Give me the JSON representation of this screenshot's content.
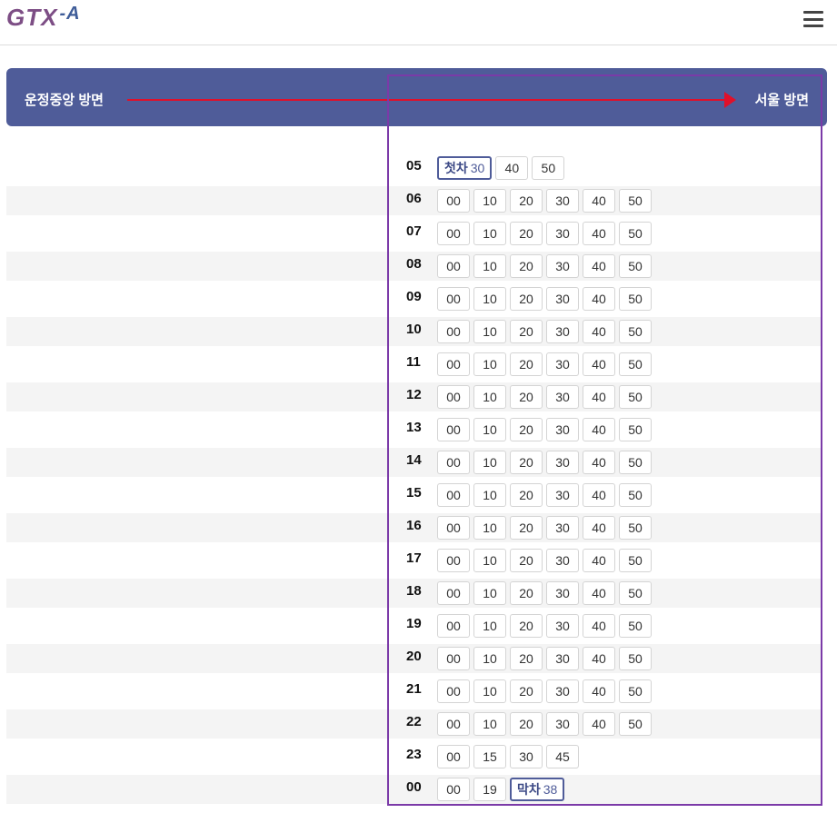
{
  "header": {
    "logo_g": "GT",
    "logo_x": "X",
    "logo_a": "-A"
  },
  "direction": {
    "from": "운정중앙 방면",
    "to": "서울 방면"
  },
  "colors": {
    "banner": "#4f5c99",
    "arrow": "#e0102a",
    "frame": "#7b3aa8"
  },
  "schedule": [
    {
      "hour": "05",
      "mins": [
        {
          "tag": "첫차",
          "m": "30"
        },
        {
          "m": "40"
        },
        {
          "m": "50"
        }
      ]
    },
    {
      "hour": "06",
      "mins": [
        {
          "m": "00"
        },
        {
          "m": "10"
        },
        {
          "m": "20"
        },
        {
          "m": "30"
        },
        {
          "m": "40"
        },
        {
          "m": "50"
        }
      ]
    },
    {
      "hour": "07",
      "mins": [
        {
          "m": "00"
        },
        {
          "m": "10"
        },
        {
          "m": "20"
        },
        {
          "m": "30"
        },
        {
          "m": "40"
        },
        {
          "m": "50"
        }
      ]
    },
    {
      "hour": "08",
      "mins": [
        {
          "m": "00"
        },
        {
          "m": "10"
        },
        {
          "m": "20"
        },
        {
          "m": "30"
        },
        {
          "m": "40"
        },
        {
          "m": "50"
        }
      ]
    },
    {
      "hour": "09",
      "mins": [
        {
          "m": "00"
        },
        {
          "m": "10"
        },
        {
          "m": "20"
        },
        {
          "m": "30"
        },
        {
          "m": "40"
        },
        {
          "m": "50"
        }
      ]
    },
    {
      "hour": "10",
      "mins": [
        {
          "m": "00"
        },
        {
          "m": "10"
        },
        {
          "m": "20"
        },
        {
          "m": "30"
        },
        {
          "m": "40"
        },
        {
          "m": "50"
        }
      ]
    },
    {
      "hour": "11",
      "mins": [
        {
          "m": "00"
        },
        {
          "m": "10"
        },
        {
          "m": "20"
        },
        {
          "m": "30"
        },
        {
          "m": "40"
        },
        {
          "m": "50"
        }
      ]
    },
    {
      "hour": "12",
      "mins": [
        {
          "m": "00"
        },
        {
          "m": "10"
        },
        {
          "m": "20"
        },
        {
          "m": "30"
        },
        {
          "m": "40"
        },
        {
          "m": "50"
        }
      ]
    },
    {
      "hour": "13",
      "mins": [
        {
          "m": "00"
        },
        {
          "m": "10"
        },
        {
          "m": "20"
        },
        {
          "m": "30"
        },
        {
          "m": "40"
        },
        {
          "m": "50"
        }
      ]
    },
    {
      "hour": "14",
      "mins": [
        {
          "m": "00"
        },
        {
          "m": "10"
        },
        {
          "m": "20"
        },
        {
          "m": "30"
        },
        {
          "m": "40"
        },
        {
          "m": "50"
        }
      ]
    },
    {
      "hour": "15",
      "mins": [
        {
          "m": "00"
        },
        {
          "m": "10"
        },
        {
          "m": "20"
        },
        {
          "m": "30"
        },
        {
          "m": "40"
        },
        {
          "m": "50"
        }
      ]
    },
    {
      "hour": "16",
      "mins": [
        {
          "m": "00"
        },
        {
          "m": "10"
        },
        {
          "m": "20"
        },
        {
          "m": "30"
        },
        {
          "m": "40"
        },
        {
          "m": "50"
        }
      ]
    },
    {
      "hour": "17",
      "mins": [
        {
          "m": "00"
        },
        {
          "m": "10"
        },
        {
          "m": "20"
        },
        {
          "m": "30"
        },
        {
          "m": "40"
        },
        {
          "m": "50"
        }
      ]
    },
    {
      "hour": "18",
      "mins": [
        {
          "m": "00"
        },
        {
          "m": "10"
        },
        {
          "m": "20"
        },
        {
          "m": "30"
        },
        {
          "m": "40"
        },
        {
          "m": "50"
        }
      ]
    },
    {
      "hour": "19",
      "mins": [
        {
          "m": "00"
        },
        {
          "m": "10"
        },
        {
          "m": "20"
        },
        {
          "m": "30"
        },
        {
          "m": "40"
        },
        {
          "m": "50"
        }
      ]
    },
    {
      "hour": "20",
      "mins": [
        {
          "m": "00"
        },
        {
          "m": "10"
        },
        {
          "m": "20"
        },
        {
          "m": "30"
        },
        {
          "m": "40"
        },
        {
          "m": "50"
        }
      ]
    },
    {
      "hour": "21",
      "mins": [
        {
          "m": "00"
        },
        {
          "m": "10"
        },
        {
          "m": "20"
        },
        {
          "m": "30"
        },
        {
          "m": "40"
        },
        {
          "m": "50"
        }
      ]
    },
    {
      "hour": "22",
      "mins": [
        {
          "m": "00"
        },
        {
          "m": "10"
        },
        {
          "m": "20"
        },
        {
          "m": "30"
        },
        {
          "m": "40"
        },
        {
          "m": "50"
        }
      ]
    },
    {
      "hour": "23",
      "mins": [
        {
          "m": "00"
        },
        {
          "m": "15"
        },
        {
          "m": "30"
        },
        {
          "m": "45"
        }
      ]
    },
    {
      "hour": "00",
      "mins": [
        {
          "m": "00"
        },
        {
          "m": "19"
        },
        {
          "tag": "막차",
          "m": "38"
        }
      ]
    }
  ]
}
